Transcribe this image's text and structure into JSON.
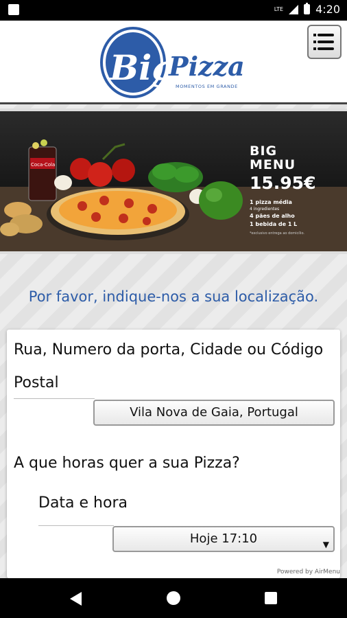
{
  "status_bar": {
    "time": "4:20",
    "network": "LTE"
  },
  "header": {
    "logo": {
      "word1": "Big",
      "word2": "Pizza",
      "tagline": "MOMENTOS EM GRANDE"
    },
    "menu_icon": "hamburger-menu-icon"
  },
  "banner": {
    "title_line1": "BIG",
    "title_line2": "MENU",
    "price": "15.95€",
    "items": [
      "1 pizza média",
      "4 ingredientes",
      "4 pães de alho",
      "1 bebida de 1 L"
    ],
    "note": "*exclusivo entrega ao domicílio.",
    "brand_label": "Coca-Cola"
  },
  "location_prompt": "Por favor, indique-nos a sua localização.",
  "form": {
    "address_label": "Rua, Numero da porta, Cidade ou Código Postal",
    "address_value": "Vila Nova de Gaia, Portugal",
    "time_question": "A que horas quer a sua Pizza?",
    "datetime_label": "Data e hora",
    "datetime_value": "Hoje 17:10"
  },
  "footer": {
    "powered_by": "Powered by AirMenu"
  },
  "colors": {
    "brand_blue": "#2d5ca8",
    "header_bg": "#ffffff"
  }
}
